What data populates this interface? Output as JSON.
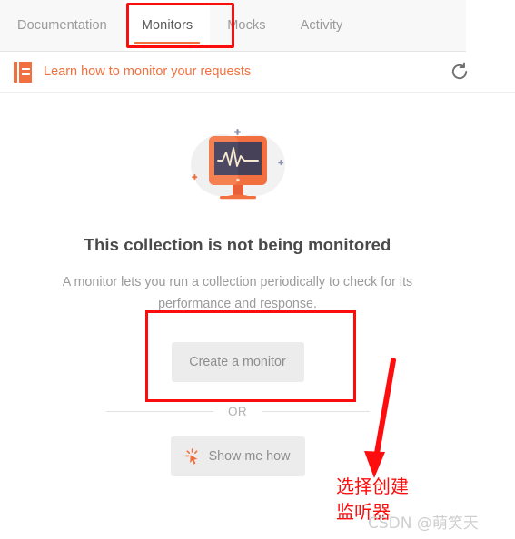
{
  "tabs": [
    {
      "label": "Documentation",
      "active": false
    },
    {
      "label": "Monitors",
      "active": true
    },
    {
      "label": "Mocks",
      "active": false
    },
    {
      "label": "Activity",
      "active": false
    }
  ],
  "learn_row": {
    "icon": "book-icon",
    "link_label": "Learn how to monitor your requests",
    "refresh_icon": "refresh-icon"
  },
  "empty_state": {
    "illustration": "monitor-heartbeat-illustration",
    "title": "This collection is not being monitored",
    "description": "A monitor lets you run a collection periodically to check for its performance and response.",
    "create_button_label": "Create a monitor",
    "divider_label": "OR",
    "show_button_label": "Show me how",
    "show_button_icon": "click-cursor-icon"
  },
  "annotations": {
    "tab_highlight": "monitors-tab-highlight",
    "create_highlight": "create-monitor-highlight",
    "arrow": "down-arrow",
    "note_line1": "选择创建",
    "note_line2": "监听器"
  },
  "watermark": "CSDN @萌笑天",
  "colors": {
    "accent": "#f2703f",
    "annotation_red": "#fc0d0d",
    "tabbar_bg": "#f8f8f8",
    "button_bg": "#ececec",
    "title_text": "#4a4a4a",
    "muted_text": "#9b9b9b",
    "screen_dark": "#464159",
    "blob_grey": "#f0f0f0"
  }
}
